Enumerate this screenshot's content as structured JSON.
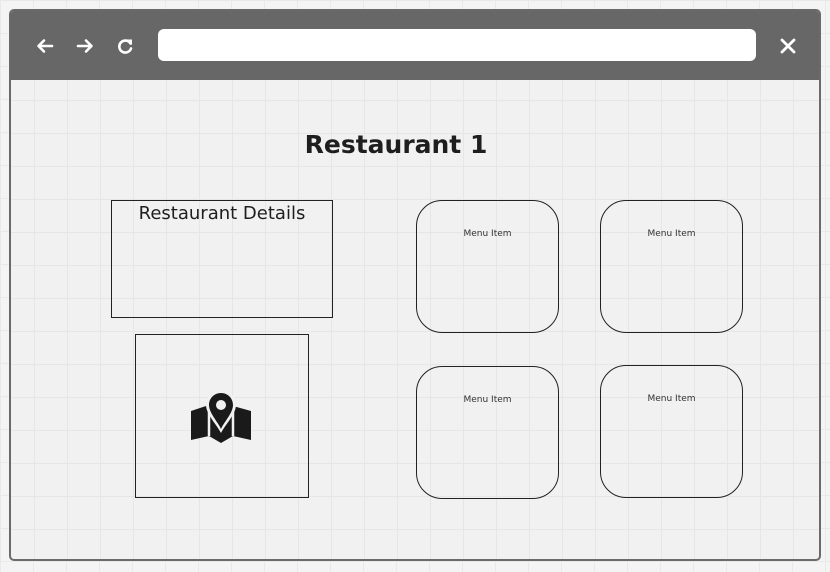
{
  "browser": {
    "back_icon": "arrow-left-icon",
    "forward_icon": "arrow-right-icon",
    "reload_icon": "reload-icon",
    "close_icon": "close-icon",
    "address_value": ""
  },
  "page": {
    "title": "Restaurant 1"
  },
  "details": {
    "label": "Restaurant Details"
  },
  "map": {
    "icon": "map-pin-icon"
  },
  "menu": {
    "items": [
      {
        "label": "Menu Item"
      },
      {
        "label": "Menu Item"
      },
      {
        "label": "Menu Item"
      },
      {
        "label": "Menu Item"
      }
    ]
  }
}
